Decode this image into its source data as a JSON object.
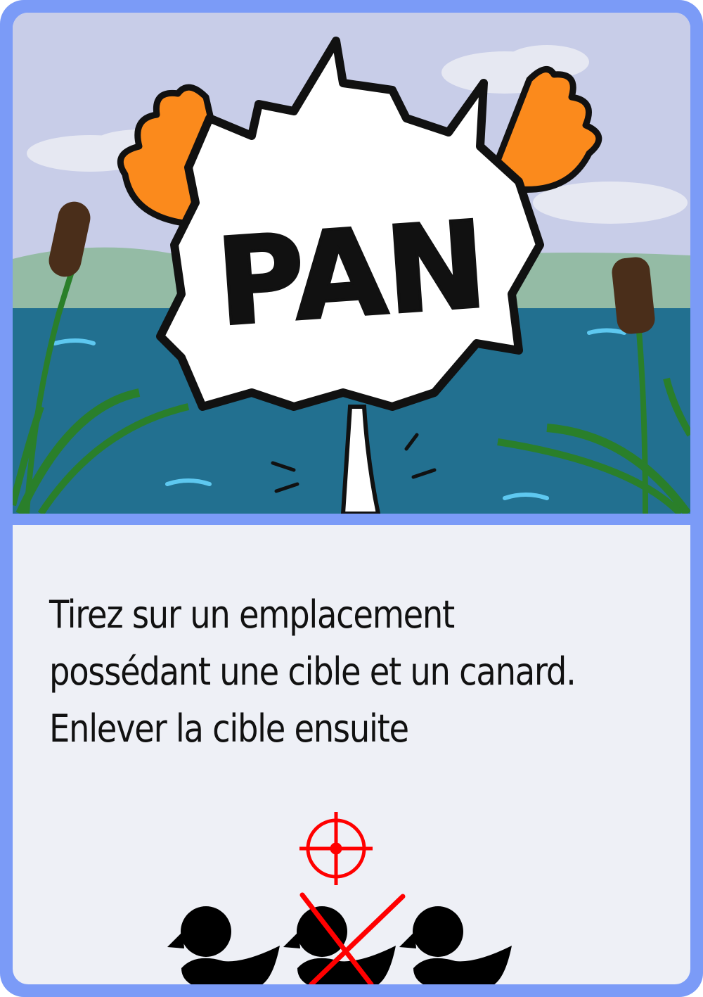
{
  "card": {
    "border_color": "#7b9bf7",
    "background_color": "#eef0f6",
    "illustration": {
      "sound_effect_text": "PAN",
      "scene": "pond with reeds, orange duck feet and white explosion burst",
      "colors": {
        "sky": "#c8cde8",
        "water": "#227090",
        "reeds": "#2a7f2a",
        "cattail": "#4a2e1a",
        "duck_feet": "#fb8a1c",
        "burst": "#ffffff"
      }
    },
    "rule_text": {
      "line1": "Tirez sur un emplacement",
      "line2": "possédant une cible et un canard.",
      "line3": "Enlever la cible ensuite"
    },
    "diagram": {
      "target_icon": "crosshair-icon",
      "target_color": "#ff0000",
      "ducks": [
        {
          "icon": "duck-icon",
          "crossed_out": false
        },
        {
          "icon": "duck-icon",
          "crossed_out": true
        },
        {
          "icon": "duck-icon",
          "crossed_out": false
        }
      ],
      "cross_color": "#ff0000"
    }
  }
}
